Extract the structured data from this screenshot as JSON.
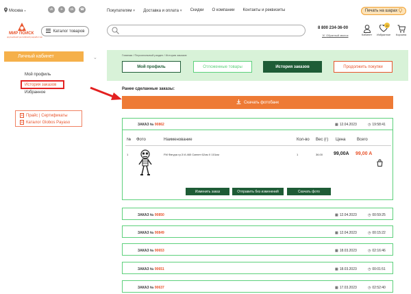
{
  "topbar": {
    "city": "Москва",
    "social": [
      {
        "icon": "vk-icon",
        "glyph": "vk"
      },
      {
        "icon": "telegram-icon",
        "glyph": "✈"
      },
      {
        "icon": "odnoklassniki-icon",
        "glyph": "ok"
      },
      {
        "icon": "whatsapp-icon",
        "glyph": "☎"
      }
    ],
    "nav": [
      "Покупателям",
      "Доставка и оплата",
      "Скидки",
      "О компании",
      "Контакты и реквизиты"
    ],
    "print_btn": "Печать на шарах"
  },
  "header": {
    "logo_text": "МИР ПОИСК",
    "logo_sub": "крупнейший российский разработчик",
    "catalog_btn": "Каталог товаров",
    "search_placeholder": "",
    "phone": "8 800 234-36-00",
    "callback": "Обратный звонок",
    "icons": [
      {
        "name": "cabinet-icon",
        "label": "Кабинет"
      },
      {
        "name": "favorites-icon",
        "label": "Избранное",
        "badge": "11"
      },
      {
        "name": "cart-icon",
        "label": "Корзина"
      }
    ]
  },
  "sidebar": {
    "header": "Личный кабинет",
    "links": [
      "Мой профиль",
      "История заказов",
      "Избранное"
    ],
    "active_index": 1,
    "docs": [
      "Прайс | Сертификаты",
      "Каталог Globos Payaso"
    ]
  },
  "panel": {
    "breadcrumb": "Главная / Персональный раздел / История заказов",
    "buttons": [
      "Мой профиль",
      "Отложенные товары",
      "История заказов",
      "Продолжить покупки"
    ]
  },
  "main": {
    "recent_title": "Ранее сделанные заказы:",
    "download_btn": "Скачать фотобанк"
  },
  "order": {
    "label": "ЗАКАЗ №",
    "number": "90862",
    "date": "12.04.2023",
    "time": "19:58:41",
    "columns": [
      "№",
      "Фото",
      "Наименование",
      "Кол-во",
      "Вес (г)",
      "Цена",
      "Всего"
    ],
    "item": {
      "num": "1",
      "name": "FM Фигура гр.3 И-460 Скелет 62см X 101см",
      "qty": "1",
      "weight": "36.00",
      "price": "99,00A",
      "total": "99,00 A"
    },
    "actions": [
      "Изменить заказ",
      "Отправить без изменений",
      "Скачать фото"
    ]
  },
  "orders": [
    {
      "number": "90850",
      "date": "12.04.2023",
      "time": "00:59:25"
    },
    {
      "number": "90849",
      "date": "12.04.2023",
      "time": "00:15:22"
    },
    {
      "number": "90653",
      "date": "18.03.2023",
      "time": "02:16:46"
    },
    {
      "number": "90651",
      "date": "18.03.2023",
      "time": "00:01:51"
    },
    {
      "number": "90637",
      "date": "17.03.2023",
      "time": "02:52:40"
    }
  ],
  "colors": {
    "accent": "#e8532b",
    "orange_bar": "#ee7a35",
    "green_dark": "#1e5c36",
    "green_light": "#5bd07a",
    "panel_bg": "#d8f2d8",
    "sidebar_head": "#f5b04a"
  }
}
